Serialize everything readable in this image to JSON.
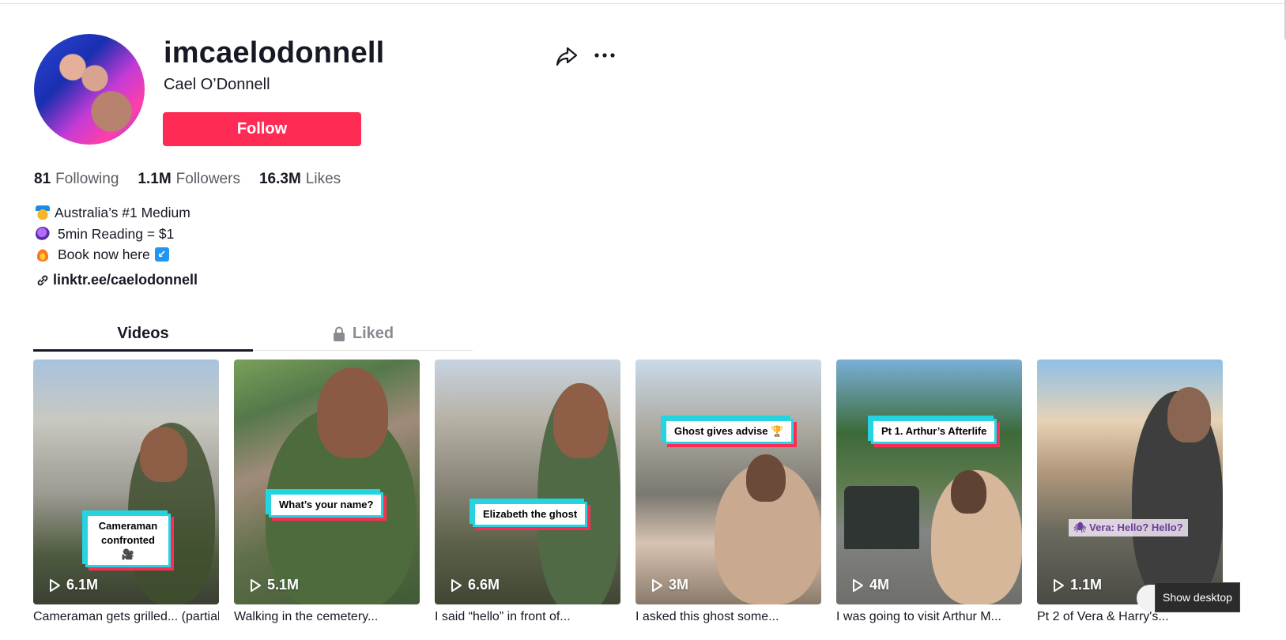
{
  "profile": {
    "username": "imcaelodonnell",
    "nickname": "Cael O’Donnell",
    "follow_label": "Follow"
  },
  "stats": {
    "following": {
      "value": "81",
      "label": "Following"
    },
    "followers": {
      "value": "1.1M",
      "label": "Followers"
    },
    "likes": {
      "value": "16.3M",
      "label": "Likes"
    }
  },
  "bio": {
    "line1": "Australia’s #1 Medium",
    "line2": "5min Reading = $1",
    "line3": "Book now here"
  },
  "link": "linktr.ee/caelodonnell",
  "tabs": {
    "videos": "Videos",
    "liked": "Liked"
  },
  "videos": [
    {
      "caption": "Cameraman confronted 🎥",
      "plays": "6.1M",
      "desc": "Cameraman gets grilled... (partially visible)"
    },
    {
      "caption": "What’s your name?",
      "plays": "5.1M",
      "desc": "Walking in the cemetery..."
    },
    {
      "caption": "Elizabeth the ghost",
      "plays": "6.6M",
      "desc": "I said “hello” in front of..."
    },
    {
      "caption": "Ghost gives advise 🏆",
      "plays": "3M",
      "desc": "I asked this ghost some..."
    },
    {
      "caption": "Pt 1. Arthur’s Afterlife",
      "plays": "4M",
      "desc": "I was going to visit Arthur M..."
    },
    {
      "caption": "🕷 Vera: Hello? Hello?",
      "plays": "1.1M",
      "desc": "Pt 2 of Vera & Harry's..."
    }
  ],
  "system": {
    "show_desktop": "Show desktop"
  }
}
